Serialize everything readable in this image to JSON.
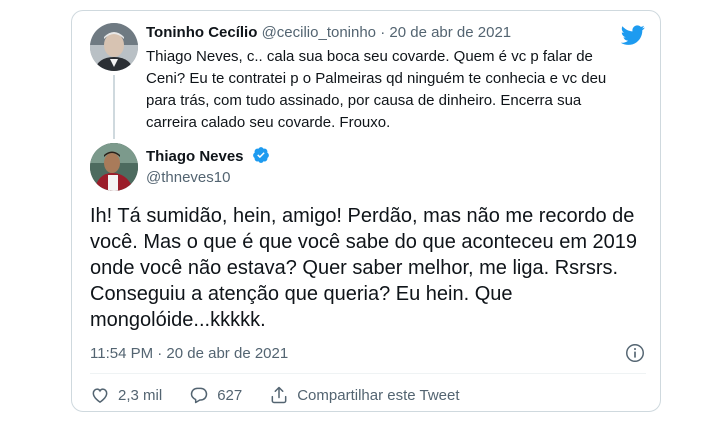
{
  "quoted": {
    "name": "Toninho Cecílio",
    "handle": "@cecilio_toninho",
    "separator": "·",
    "date": "20 de abr de 2021",
    "text": "Thiago Neves, c.. cala sua boca seu covarde. Quem é vc p falar de Ceni? Eu te contratei p o Palmeiras qd ninguém te conhecia e vc deu para trás, com tudo assinado, por causa de dinheiro. Encerra sua carreira calado seu covarde. Frouxo."
  },
  "main": {
    "name": "Thiago Neves",
    "handle": "@thneves10",
    "text": "Ih! Tá sumidão, hein, amigo! Perdão, mas não me recordo de você. Mas o que é que você sabe do que aconteceu em 2019 onde você não estava? Quer saber melhor, me liga. Rsrsrs. Conseguiu a atenção que queria? Eu hein. Que mongolóide...kkkkk.",
    "timestamp": "11:54 PM · 20 de abr de 2021"
  },
  "actions": {
    "likes": "2,3 mil",
    "replies": "627",
    "share_label": "Compartilhar este Tweet"
  },
  "colors": {
    "twitter_blue": "#1d9bf0",
    "secondary_text": "#536471",
    "border": "#cfd9de"
  },
  "icons": [
    "twitter-logo-icon",
    "verified-badge-icon",
    "info-icon",
    "heart-icon",
    "reply-icon",
    "share-icon"
  ]
}
